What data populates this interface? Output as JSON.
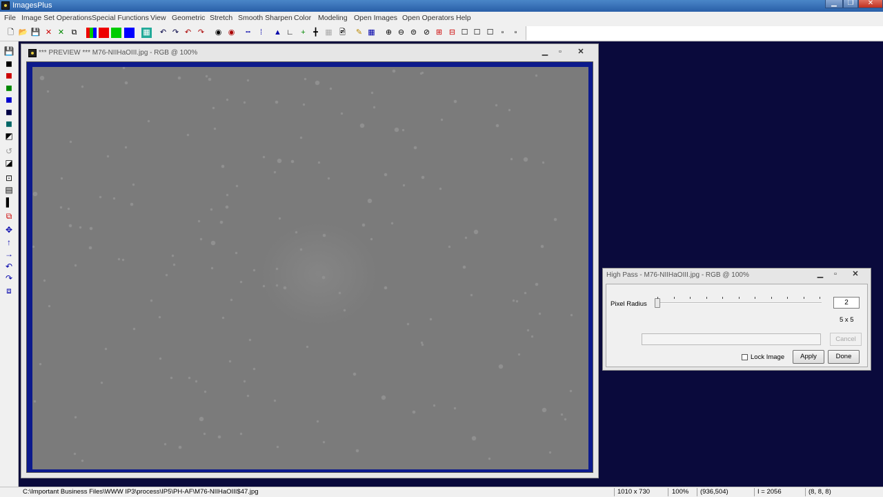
{
  "app": {
    "title": "ImagesPlus"
  },
  "menu": [
    "File",
    "Image Set Operations",
    "Special Functions",
    "View",
    "Geometric",
    "Stretch",
    "Smooth Sharpen",
    "Color",
    "Modeling",
    "Open Images",
    "Open Operators",
    "Help"
  ],
  "preview_window": {
    "title": "*** PREVIEW *** M76-NIIHaOIII.jpg - RGB @ 100%"
  },
  "high_pass": {
    "title": "High Pass - M76-NIIHaOIII.jpg - RGB @ 100%",
    "pixel_radius_label": "Pixel Radius",
    "pixel_radius_value": "2",
    "slider_position": 0.0,
    "kernel_size": "5 x 5",
    "cancel_label": "Cancel",
    "lock_image_label": "Lock Image",
    "lock_image_checked": false,
    "apply_label": "Apply",
    "done_label": "Done"
  },
  "status": {
    "path": "C:\\Important Business Files\\WWW IP3\\process\\IP5\\PH-AF\\M76-NIIHaOIII$47.jpg",
    "dimensions": "1010 x 730",
    "zoom": "100%",
    "cursor": "(936,504)",
    "intensity": "I = 2056",
    "rgb": "(8, 8, 8)"
  },
  "colors": {
    "workspace": "#0a0a3c",
    "image_frame": "#0c1a8c",
    "image_gray": "#7b7b7b"
  }
}
